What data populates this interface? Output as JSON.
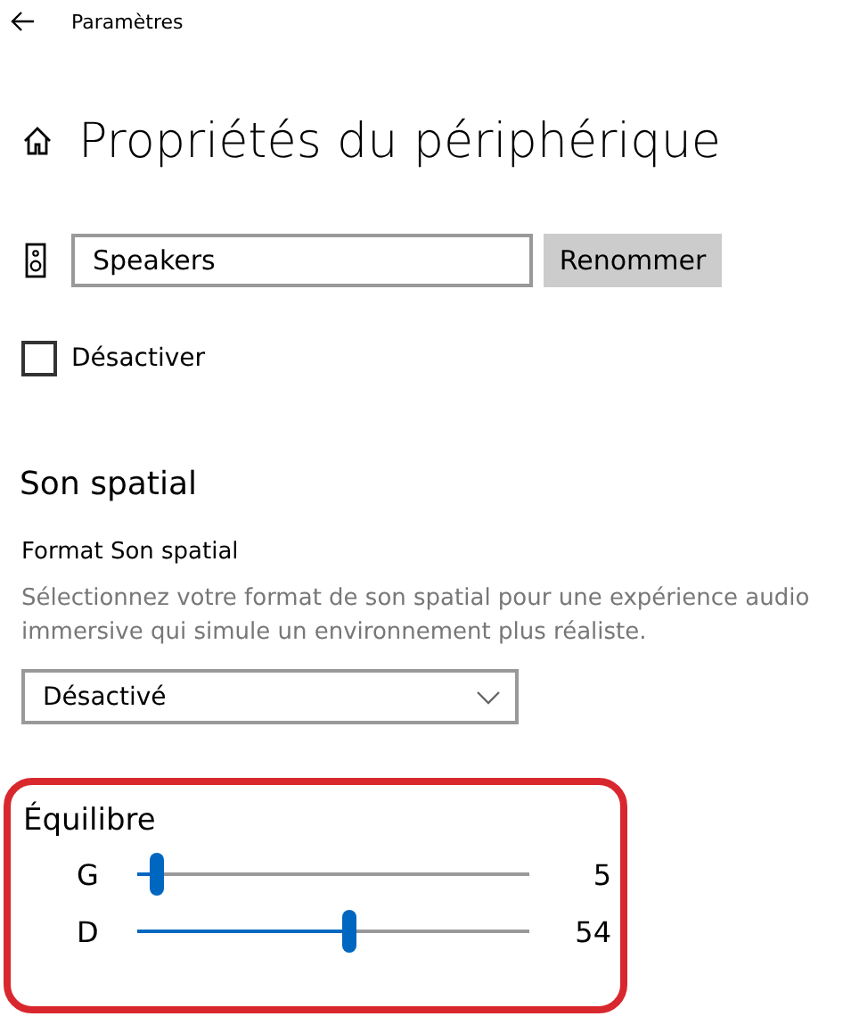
{
  "header": {
    "app_title": "Paramètres"
  },
  "page_title": "Propriétés du périphérique",
  "device": {
    "name_value": "Speakers",
    "rename_button": "Renommer"
  },
  "disable": {
    "label": "Désactiver",
    "checked": false
  },
  "spatial_sound": {
    "heading": "Son spatial",
    "format_label": "Format Son spatial",
    "description": "Sélectionnez votre format de son spatial pour une expérience audio immersive qui simule un environnement plus réaliste.",
    "dropdown_value": "Désactivé"
  },
  "balance": {
    "heading": "Équilibre",
    "highlighted": true,
    "channels": [
      {
        "label": "G",
        "level": 0.05,
        "reading": "5"
      },
      {
        "label": "D",
        "level": 0.54,
        "reading": "54"
      }
    ]
  }
}
